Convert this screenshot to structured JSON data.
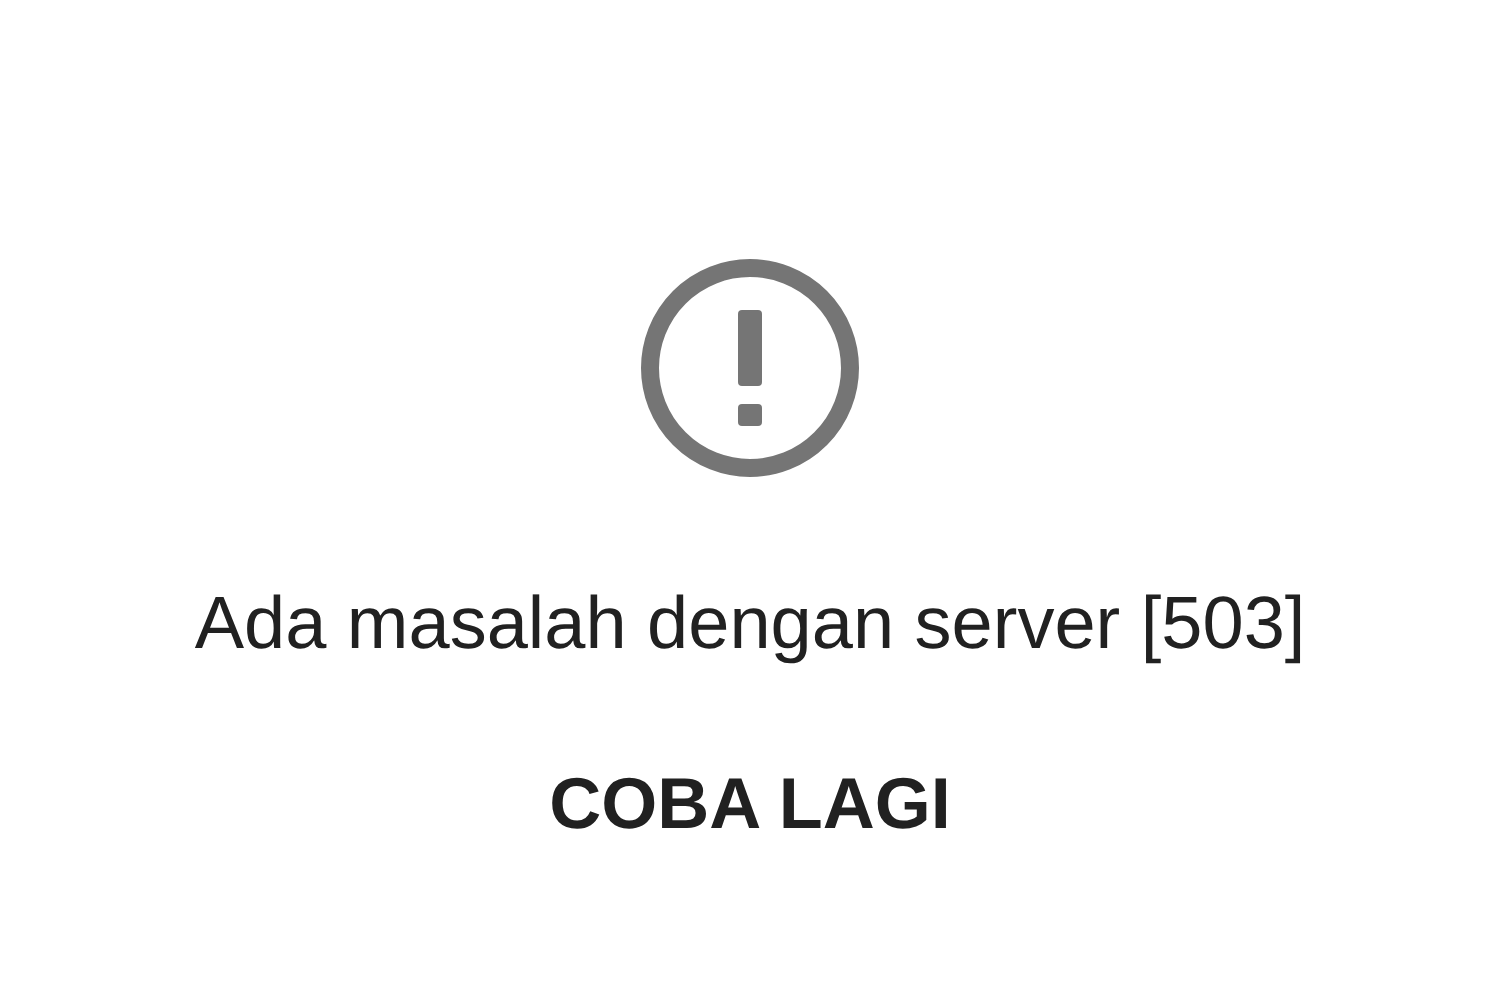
{
  "message": {
    "text": "Ada masalah dengan server [503]"
  },
  "retry_button": {
    "label": "COBA LAGI"
  }
}
